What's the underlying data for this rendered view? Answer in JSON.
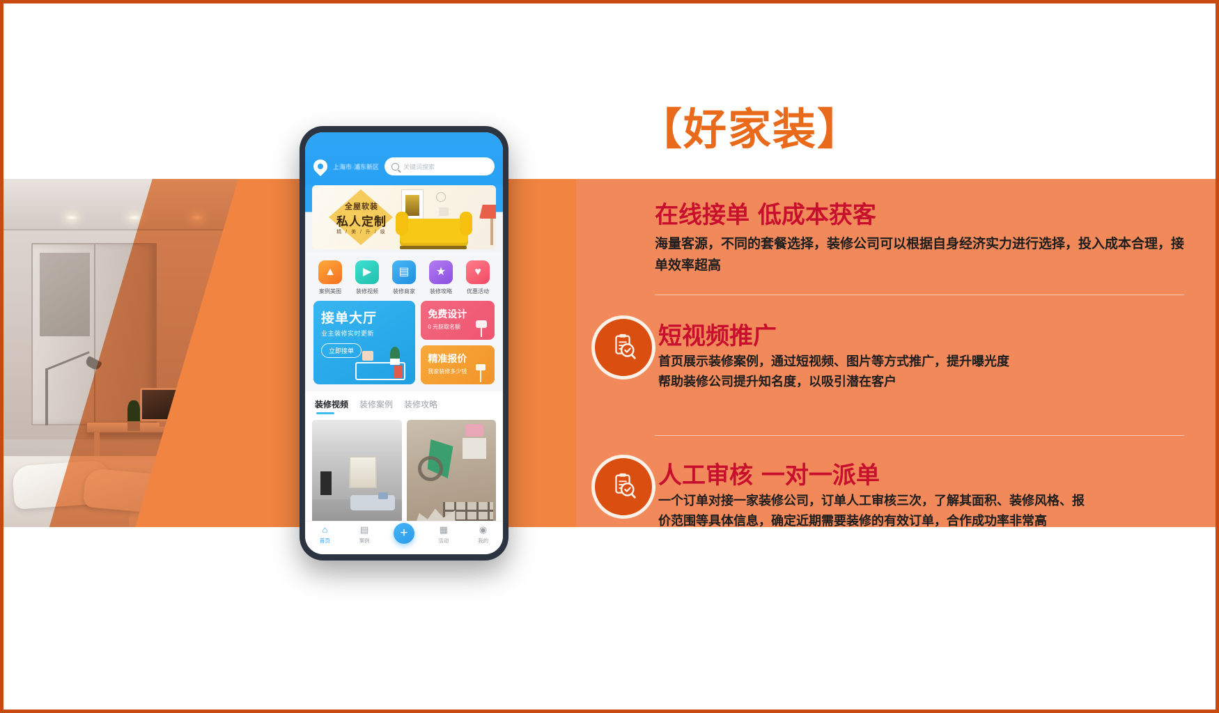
{
  "poster": {
    "brand_title": "【好家装】",
    "accent_orange": "#ea6a1c",
    "panel_orange": "#f1895a",
    "heading_red": "#c8102e",
    "border_color": "#c84a10"
  },
  "sections": [
    {
      "title": "在线接单  低成本获客",
      "body": "海量客源，不同的套餐选择，装修公司可以根据自身经济实力进行选择，投入成本合理，接单效率超高",
      "icon": ""
    },
    {
      "title": "短视频推广",
      "body_line1": "首页展示装修案例，通过短视频、图片等方式推广，提升曝光度",
      "body_line2": "帮助装修公司提升知名度，以吸引潜在客户",
      "icon": "clipboard-search-icon"
    },
    {
      "title": "人工审核 一对一派单",
      "body_line1": "一个订单对接一家装修公司，订单人工审核三次，了解其面积、装修风格、报",
      "body_line2": "价范围等具体信息，确定近期需要装修的有效订单，合作成功率非常高",
      "icon": "clipboard-search-icon"
    }
  ],
  "phone": {
    "header": {
      "location_text": "上海市·浦东新区",
      "location_icon": "location-pin-icon",
      "search_icon": "search-icon",
      "search_placeholder": "关键词搜索"
    },
    "banner": {
      "line1": "全屋软装",
      "line2": "私人定制",
      "line3": "精 / 美 / 升 / 级"
    },
    "quicknav": [
      {
        "label": "案例美图",
        "icon": "image-icon",
        "glyph": "🖼"
      },
      {
        "label": "装修视频",
        "icon": "video-camera-icon",
        "glyph": "▶"
      },
      {
        "label": "装修商家",
        "icon": "store-icon",
        "glyph": "▤"
      },
      {
        "label": "装修攻略",
        "icon": "guide-book-icon",
        "glyph": "★"
      },
      {
        "label": "优惠活动",
        "icon": "gift-icon",
        "glyph": "♥"
      }
    ],
    "promo_main": {
      "title": "接单大厅",
      "subtitle": "业主装修实时更新",
      "button": "立即接单"
    },
    "promo_cards": [
      {
        "title": "免费设计",
        "subtitle": "0 元获取名额"
      },
      {
        "title": "精准报价",
        "subtitle": "我家装修多少钱"
      }
    ],
    "tabs": [
      {
        "label": "装修视频",
        "active": true
      },
      {
        "label": "装修案例",
        "active": false
      },
      {
        "label": "装修攻略",
        "active": false
      }
    ],
    "bottom_nav": [
      {
        "label": "首页",
        "icon": "home-icon",
        "glyph": "⌂",
        "active": true
      },
      {
        "label": "案例",
        "icon": "grid-icon",
        "glyph": "▤",
        "active": false
      },
      {
        "label": "",
        "icon": "plus-fab-icon",
        "glyph": "+",
        "active": false
      },
      {
        "label": "活动",
        "icon": "calendar-icon",
        "glyph": "▦",
        "active": false
      },
      {
        "label": "我的",
        "icon": "user-icon",
        "glyph": "◉",
        "active": false
      }
    ]
  }
}
